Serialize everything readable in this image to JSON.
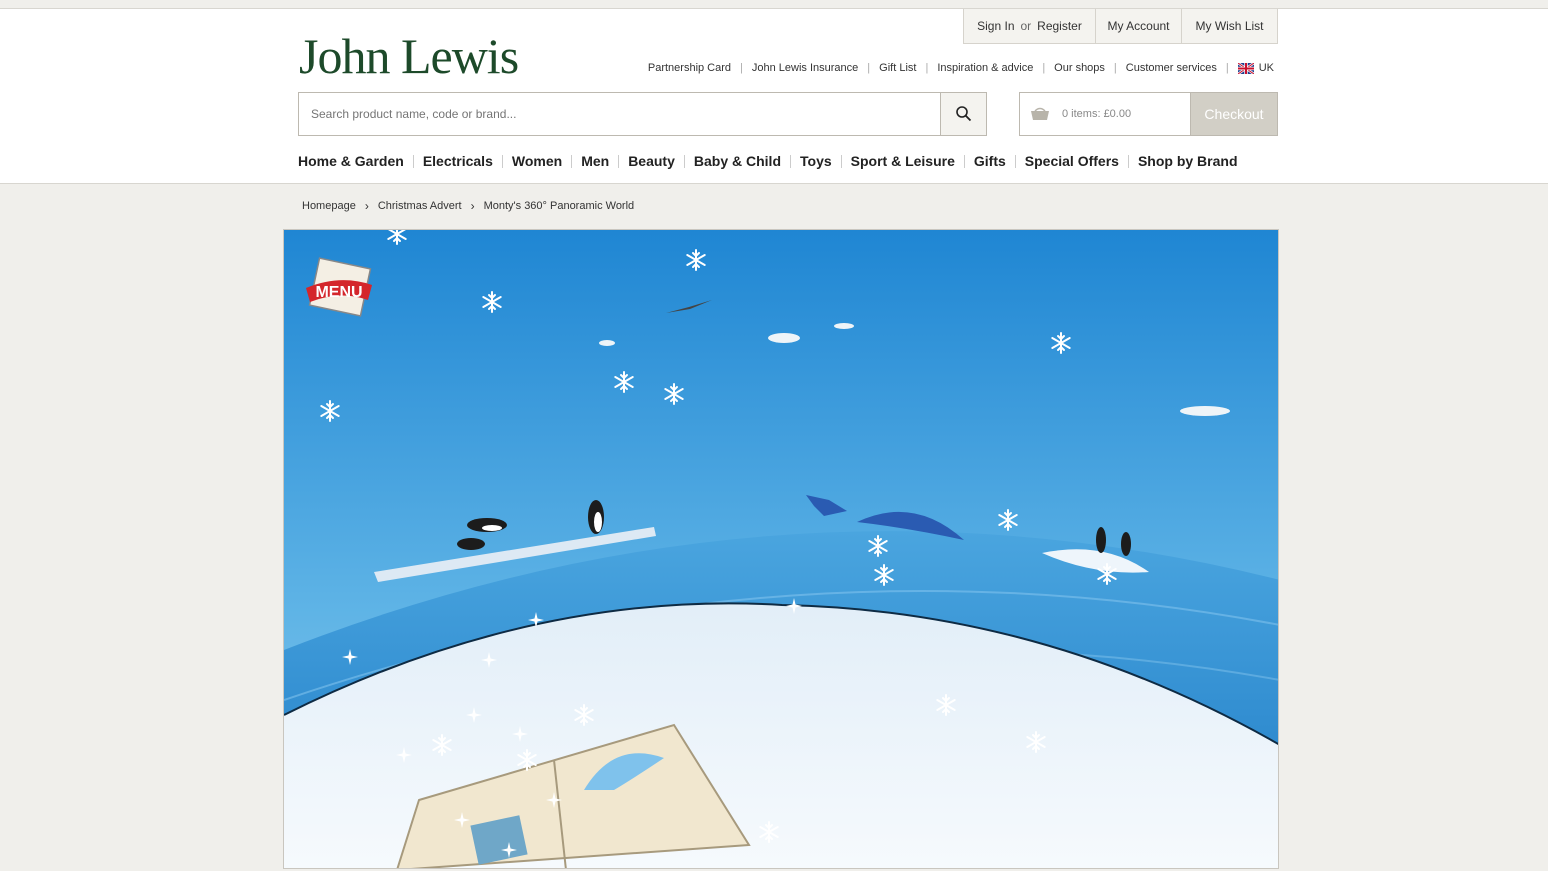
{
  "logo": "John Lewis",
  "account": {
    "sign_in": "Sign In",
    "or": "or",
    "register": "Register",
    "my_account": "My Account",
    "wish_list": "My Wish List"
  },
  "utility_links": [
    "Partnership Card",
    "John Lewis Insurance",
    "Gift List",
    "Inspiration & advice",
    "Our shops",
    "Customer services"
  ],
  "region": "UK",
  "search": {
    "placeholder": "Search product name, code or brand..."
  },
  "basket": {
    "summary": "0 items: £0.00",
    "checkout": "Checkout"
  },
  "nav": [
    "Home & Garden",
    "Electricals",
    "Women",
    "Men",
    "Beauty",
    "Baby & Child",
    "Toys",
    "Sport & Leisure",
    "Gifts",
    "Special Offers",
    "Shop by Brand"
  ],
  "breadcrumb": [
    "Homepage",
    "Christmas Advert",
    "Monty's 360° Panoramic World"
  ],
  "scene": {
    "menu_badge": "MENU"
  },
  "colors": {
    "brand_green": "#1d4a2a",
    "sky_top": "#1f86d3",
    "sky_bottom": "#7cc3ec",
    "sea": "#2e8fd0",
    "ice": "#eef5fb"
  }
}
